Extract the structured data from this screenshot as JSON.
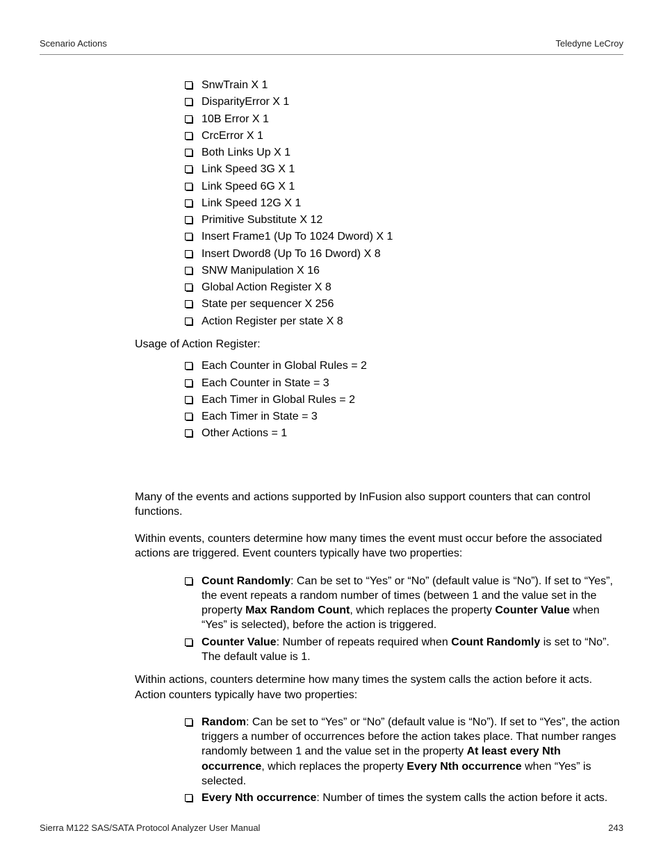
{
  "header": {
    "left": "Scenario Actions",
    "right": "Teledyne LeCroy"
  },
  "list1": [
    "SnwTrain X 1",
    "DisparityError X 1",
    "10B Error X 1",
    "CrcError X 1",
    "Both Links Up X 1",
    "Link Speed 3G X 1",
    "Link Speed 6G  X 1",
    "Link Speed 12G X 1",
    "Primitive Substitute X 12",
    "Insert Frame1 (Up To 1024 Dword) X 1",
    "Insert Dword8 (Up To 16 Dword) X 8",
    "SNW Manipulation X 16",
    "Global Action Register X 8",
    "State per sequencer X 256",
    "Action Register per state X 8"
  ],
  "usage_label": "Usage of Action Register:",
  "list2": [
    "Each Counter in Global Rules = 2",
    "Each Counter in State = 3",
    "Each Timer in Global Rules = 2",
    "Each Timer in State  = 3",
    "Other Actions = 1"
  ],
  "para1": "Many of the events and actions supported by InFusion also support counters that can control functions.",
  "para2": "Within events, counters determine how many times the event must occur before the associated actions are triggered. Event counters typically have two properties:",
  "list3": [
    [
      {
        "t": "Count Randomly",
        "b": true
      },
      {
        "t": ": Can be set to “Yes” or “No” (default value is “No”). If set to “Yes”, the event repeats a random number of times (between 1 and the value set in the property ",
        "b": false
      },
      {
        "t": "Max Random Count",
        "b": true
      },
      {
        "t": ", which replaces the property ",
        "b": false
      },
      {
        "t": "Counter Value",
        "b": true
      },
      {
        "t": " when “Yes” is selected), before the action is triggered.",
        "b": false
      }
    ],
    [
      {
        "t": "Counter Value",
        "b": true
      },
      {
        "t": ": Number of repeats required when ",
        "b": false
      },
      {
        "t": "Count Randomly",
        "b": true
      },
      {
        "t": " is set to “No”. The default value is 1.",
        "b": false
      }
    ]
  ],
  "para3": "Within actions, counters determine how many times the system calls the action before it acts. Action counters typically have two properties:",
  "list4": [
    [
      {
        "t": "Random",
        "b": true
      },
      {
        "t": ": Can be set to “Yes” or “No” (default value is “No”). If set to “Yes”, the action triggers a number of occurrences before the action takes place. That number ranges randomly between 1 and the value set in the property ",
        "b": false
      },
      {
        "t": "At least every Nth occurrence",
        "b": true
      },
      {
        "t": ", which replaces the property ",
        "b": false
      },
      {
        "t": "Every Nth occurrence",
        "b": true
      },
      {
        "t": " when “Yes” is selected.",
        "b": false
      }
    ],
    [
      {
        "t": "Every Nth occurrence",
        "b": true
      },
      {
        "t": ": Number of times the system calls the action before it acts.",
        "b": false
      }
    ]
  ],
  "footer": {
    "left": "Sierra M122 SAS/SATA Protocol Analyzer User Manual",
    "right": "243"
  }
}
